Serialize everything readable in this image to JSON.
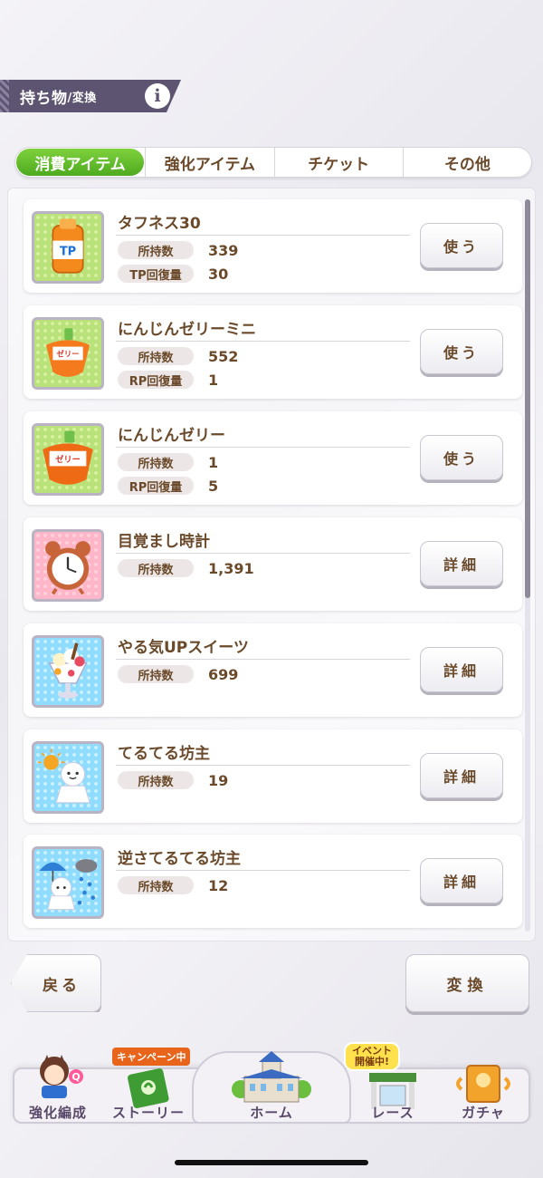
{
  "header": {
    "title_main": "持ち物",
    "title_sub": "/変換"
  },
  "tabs": [
    {
      "label": "消費アイテム",
      "active": true
    },
    {
      "label": "強化アイテム",
      "active": false
    },
    {
      "label": "チケット",
      "active": false
    },
    {
      "label": "その他",
      "active": false
    }
  ],
  "items": [
    {
      "name": "タフネス30",
      "icon": "tp-bottle-icon",
      "stats": [
        {
          "label": "所持数",
          "value": "339"
        },
        {
          "label": "TP回復量",
          "value": "30"
        }
      ],
      "action": "使う"
    },
    {
      "name": "にんじんゼリーミニ",
      "icon": "carrot-jelly-mini-icon",
      "stats": [
        {
          "label": "所持数",
          "value": "552"
        },
        {
          "label": "RP回復量",
          "value": "1"
        }
      ],
      "action": "使う"
    },
    {
      "name": "にんじんゼリー",
      "icon": "carrot-jelly-icon",
      "stats": [
        {
          "label": "所持数",
          "value": "1"
        },
        {
          "label": "RP回復量",
          "value": "5"
        }
      ],
      "action": "使う"
    },
    {
      "name": "目覚まし時計",
      "icon": "alarm-clock-icon",
      "stats": [
        {
          "label": "所持数",
          "value": "1,391"
        }
      ],
      "action": "詳細"
    },
    {
      "name": "やる気UPスイーツ",
      "icon": "parfait-icon",
      "stats": [
        {
          "label": "所持数",
          "value": "699"
        }
      ],
      "action": "詳細"
    },
    {
      "name": "てるてる坊主",
      "icon": "teru-teru-bozu-icon",
      "stats": [
        {
          "label": "所持数",
          "value": "19"
        }
      ],
      "action": "詳細"
    },
    {
      "name": "逆さてるてる坊主",
      "icon": "upside-down-teru-teru-bozu-icon",
      "stats": [
        {
          "label": "所持数",
          "value": "12"
        }
      ],
      "action": "詳細"
    }
  ],
  "buttons": {
    "back": "戻る",
    "convert": "変換"
  },
  "nav": [
    {
      "label": "強化編成",
      "badge": ""
    },
    {
      "label": "ストーリー",
      "badge": "キャンペーン中"
    },
    {
      "label": "ホーム",
      "badge": ""
    },
    {
      "label": "レース",
      "badge": "イベント開催中!"
    },
    {
      "label": "ガチャ",
      "badge": ""
    }
  ],
  "colors": {
    "accent_green": "#5cb82a",
    "text_brown": "#6b4a2b",
    "header_purple": "#5c5470"
  }
}
